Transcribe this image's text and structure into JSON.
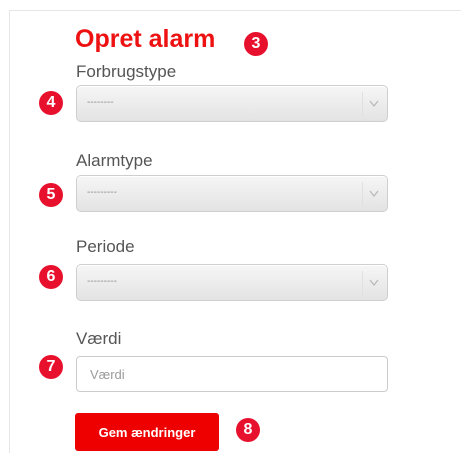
{
  "form": {
    "title": "Opret alarm",
    "fields": [
      {
        "label": "Forbrugstype",
        "selected": "--------",
        "step": "4"
      },
      {
        "label": "Alarmtype",
        "selected": "---------",
        "step": "5"
      },
      {
        "label": "Periode",
        "selected": "---------",
        "step": "6"
      }
    ],
    "value_field": {
      "label": "Værdi",
      "placeholder": "Værdi",
      "value": "",
      "step": "7"
    },
    "save_label": "Gem ændringer",
    "title_step": "3",
    "save_step": "8"
  },
  "colors": {
    "accent": "#ee0000",
    "badge": "#e8112d",
    "label": "#555555"
  },
  "icons": {
    "select_arrow": "chevron-down-icon"
  }
}
